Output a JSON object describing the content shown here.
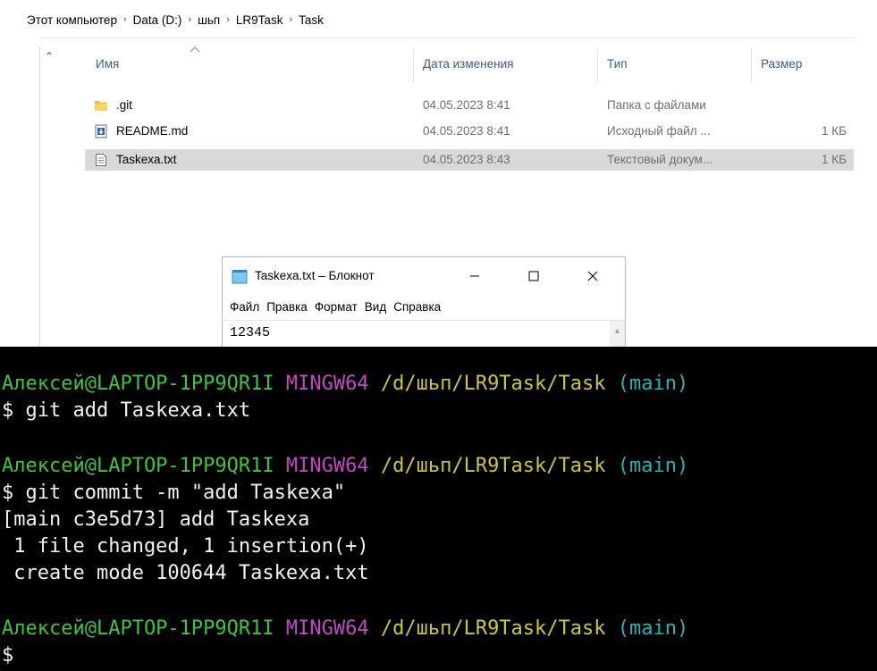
{
  "explorer": {
    "breadcrumb": [
      "Этот компьютер",
      "Data (D:)",
      "шьп",
      "LR9Task",
      "Task"
    ],
    "columns": {
      "name": "Имя",
      "date": "Дата изменения",
      "type": "Тип",
      "size": "Размер"
    },
    "files": [
      {
        "name": ".git",
        "date": "04.05.2023 8:41",
        "type": "Папка с файлами",
        "size": "",
        "icon": "folder-icon"
      },
      {
        "name": "README.md",
        "date": "04.05.2023 8:41",
        "type": "Исходный файл ...",
        "size": "1 КБ",
        "icon": "markdown-file-icon"
      },
      {
        "name": "Taskexa.txt",
        "date": "04.05.2023 8:43",
        "type": "Текстовый докум...",
        "size": "1 КБ",
        "icon": "text-file-icon",
        "selected": true
      }
    ]
  },
  "notepad": {
    "title": "Taskexa.txt – Блокнот",
    "menu": [
      "Файл",
      "Правка",
      "Формат",
      "Вид",
      "Справка"
    ],
    "content": "12345"
  },
  "terminal": {
    "prompt": {
      "user": "Алексей@LAPTOP-1PP9QR1I",
      "env": "MINGW64",
      "path": "/d/шьп/LR9Task/Task",
      "branch": "(main)"
    },
    "lines": [
      "$ git add Taskexa.txt",
      "$ git commit -m \"add Taskexa\"",
      "[main c3e5d73] add Taskexa",
      " 1 file changed, 1 insertion(+)",
      " create mode 100644 Taskexa.txt",
      "$"
    ]
  },
  "colors": {
    "selection": "#d9d9d9",
    "terminal_bg": "#000000",
    "prompt_user": "#3ec43e",
    "prompt_env": "#c249c2",
    "prompt_path": "#c9c83b",
    "prompt_branch": "#28b3b3"
  }
}
